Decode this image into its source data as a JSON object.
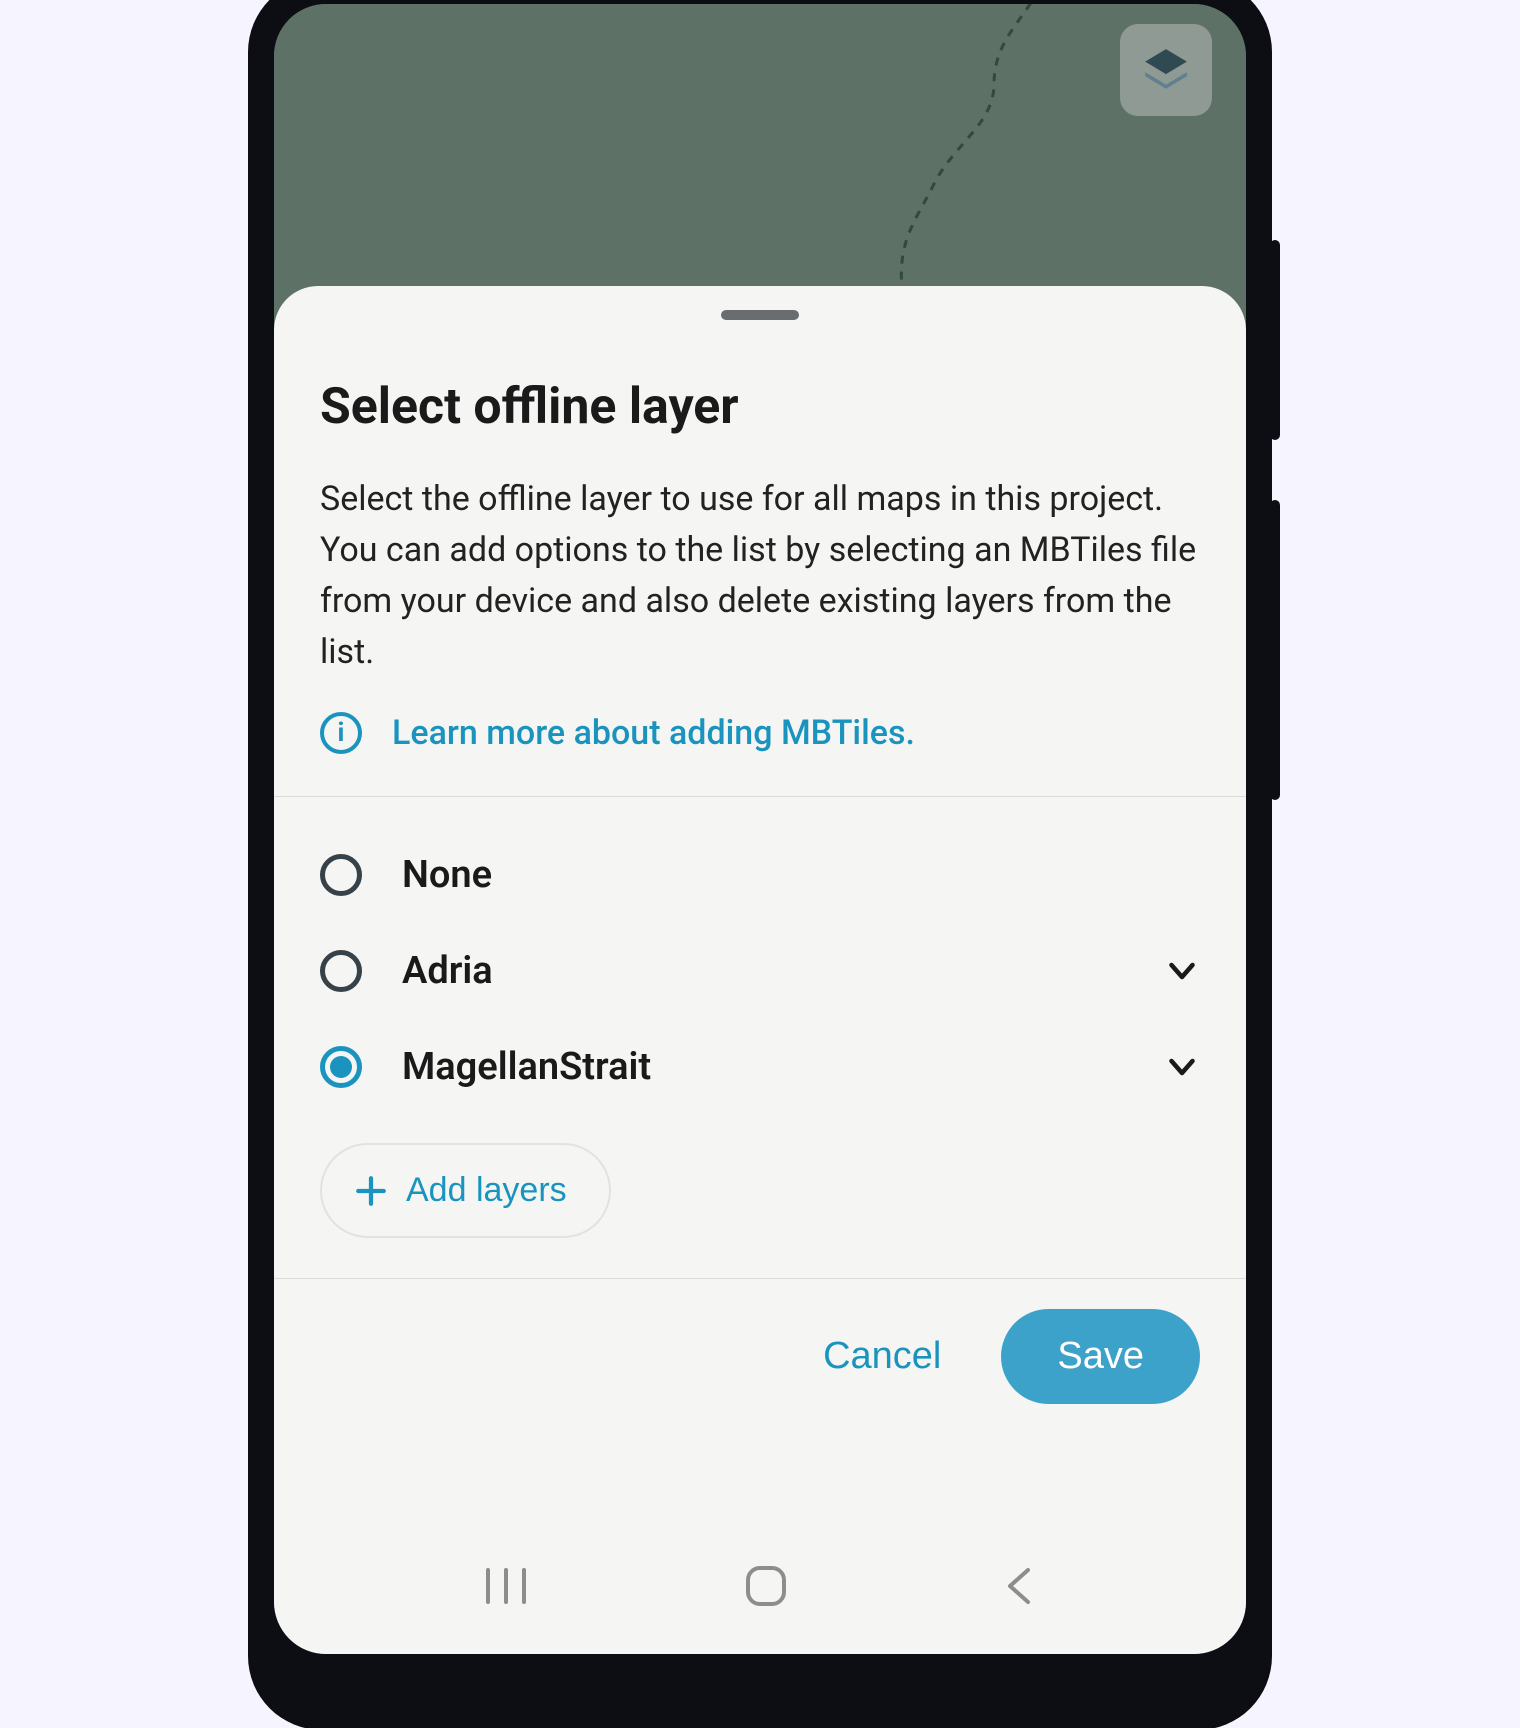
{
  "sheet": {
    "title": "Select offline layer",
    "description": "Select the offline layer to use for all maps in this project. You can add options to the list by selecting an MBTiles file from your device and also delete existing layers from the list.",
    "info_link": "Learn more about adding MBTiles.",
    "options": [
      {
        "label": "None",
        "selected": false,
        "expandable": false
      },
      {
        "label": "Adria",
        "selected": false,
        "expandable": true
      },
      {
        "label": "MagellanStrait",
        "selected": true,
        "expandable": true
      }
    ],
    "add_layers_label": "Add layers",
    "cancel_label": "Cancel",
    "save_label": "Save"
  },
  "colors": {
    "accent": "#1a94bf",
    "save_bg": "#3ca2c9"
  }
}
